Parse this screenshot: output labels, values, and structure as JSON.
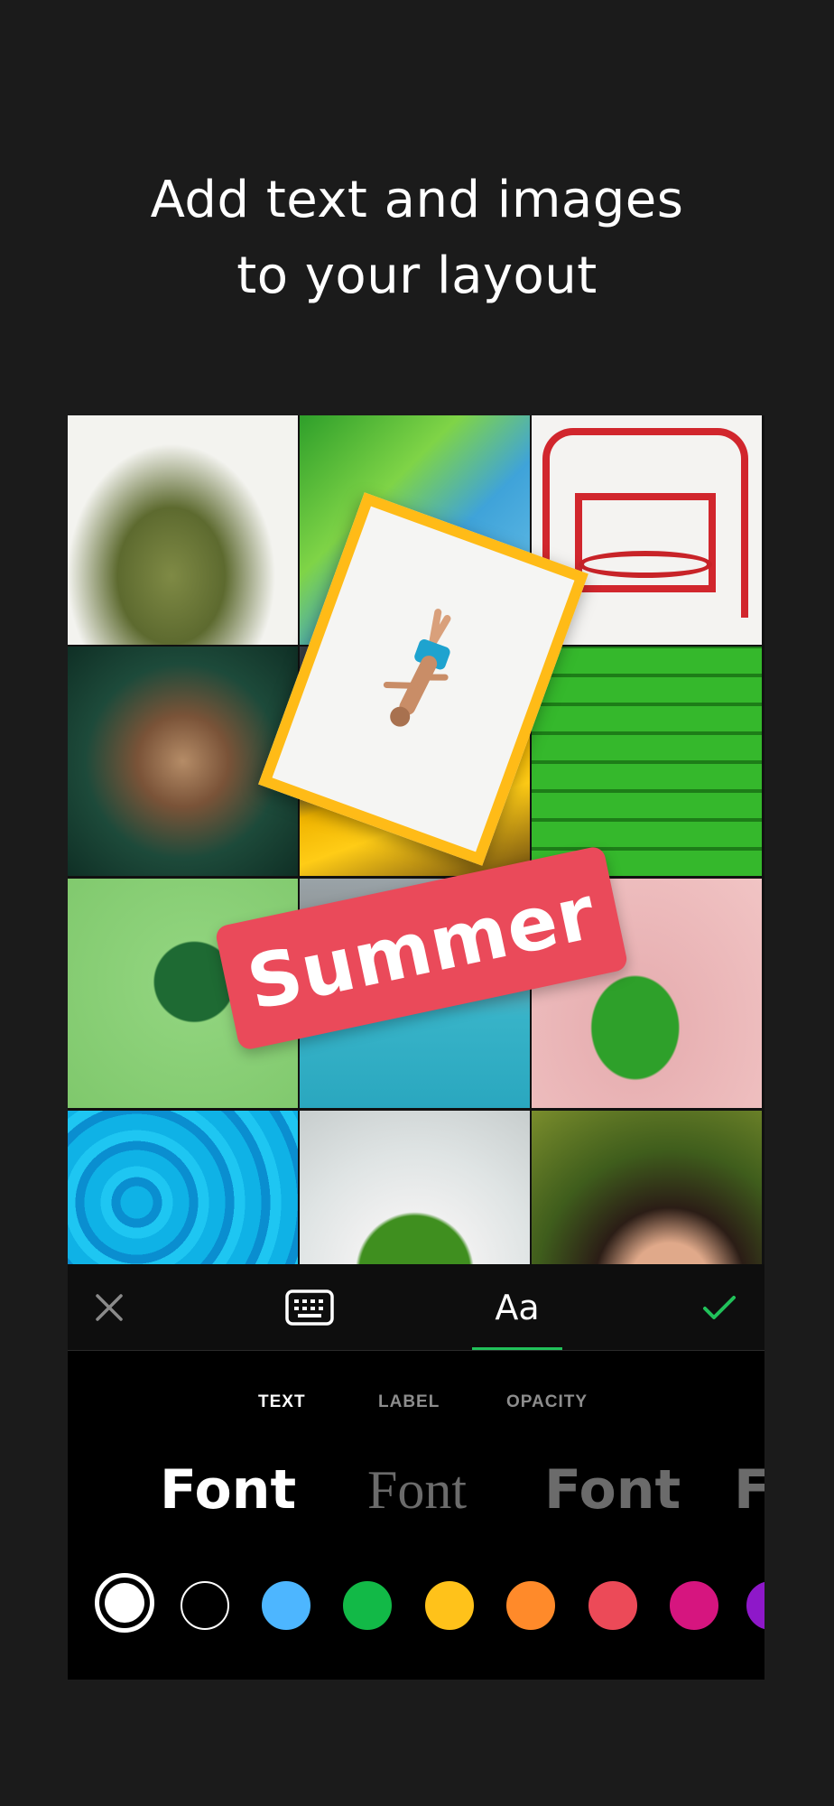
{
  "headline": {
    "line1": "Add text and images",
    "line2": "to your layout"
  },
  "canvas": {
    "label_text": "Summer",
    "label_color": "#ea4a5a",
    "sticker_border_color": "#ffbb17"
  },
  "toolbar": {
    "close_icon": "close-icon",
    "keyboard_icon": "keyboard-icon",
    "style_tab_label": "Aa",
    "confirm_icon": "checkmark-icon",
    "accent_color": "#21c15a"
  },
  "tabs": {
    "items": [
      "TEXT",
      "LABEL",
      "OPACITY"
    ],
    "active": "TEXT"
  },
  "fonts": {
    "items": [
      "Font",
      "Font",
      "Font",
      "F"
    ],
    "selected_index": 0
  },
  "colors": {
    "swatches": [
      "#ffffff",
      "#000000",
      "#4db6ff",
      "#12b947",
      "#ffc21a",
      "#ff8a2a",
      "#ec4a58",
      "#d6157f",
      "#8e18c9"
    ],
    "selected_index": 0
  }
}
